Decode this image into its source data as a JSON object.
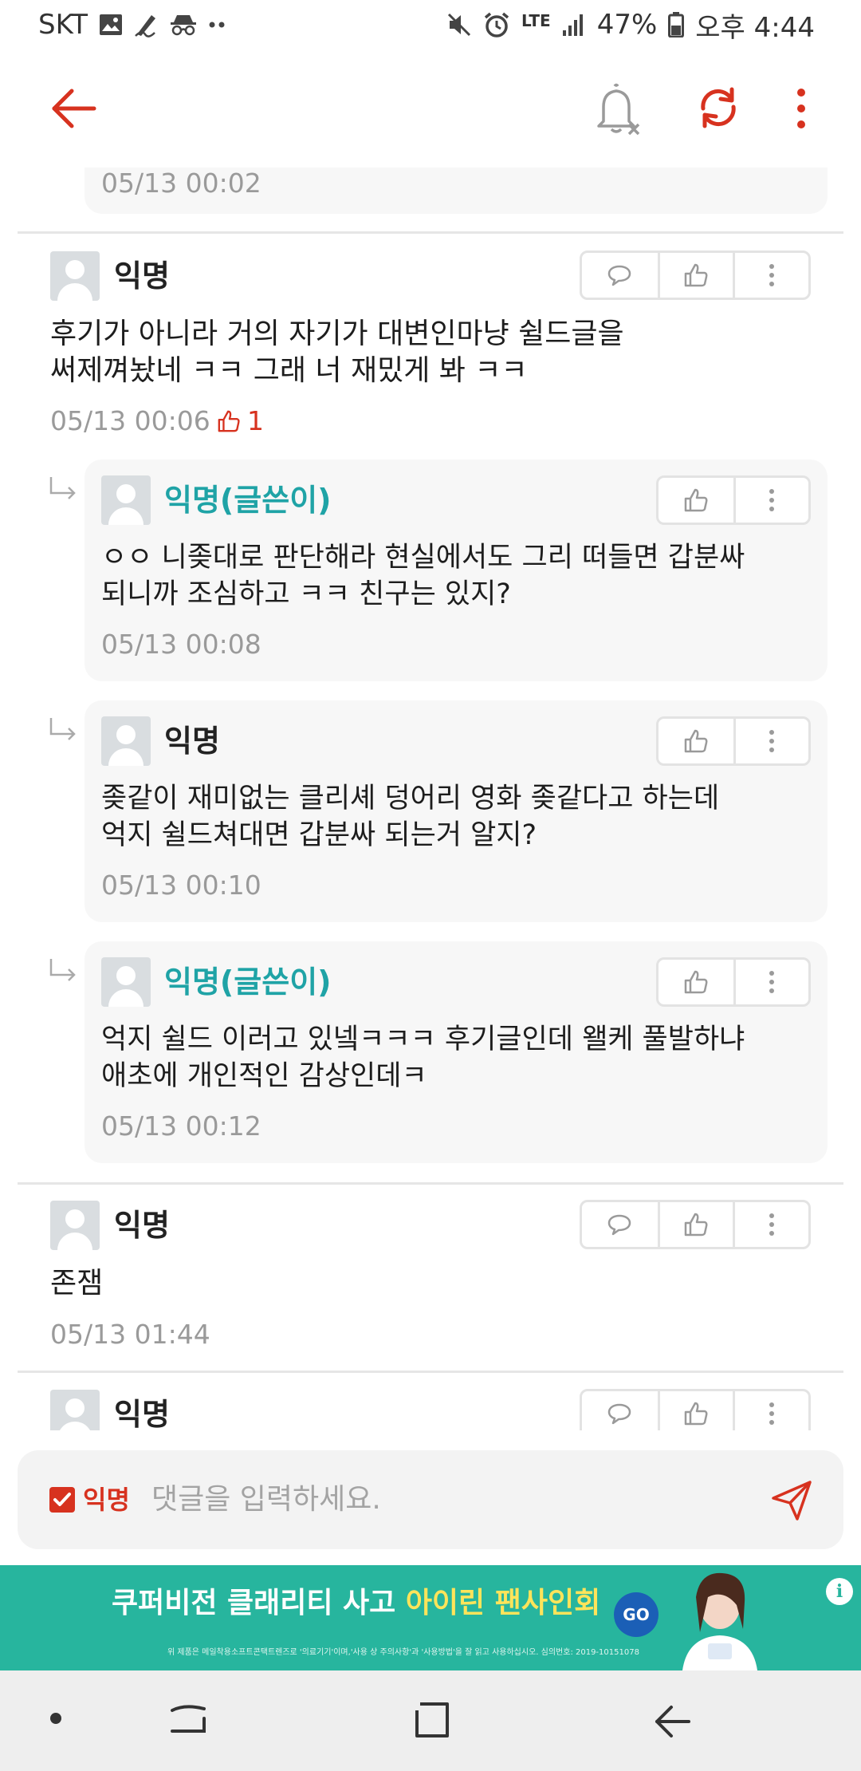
{
  "status_bar": {
    "carrier": "SKT",
    "network": "LTE",
    "battery": "47%",
    "time": "오후 4:44"
  },
  "app_bar": {
    "icons": [
      "back-arrow-icon",
      "bell-off-icon",
      "refresh-icon",
      "more-vertical-icon"
    ]
  },
  "comments": {
    "top_partial": {
      "date": "05/13 00:02"
    },
    "c1": {
      "name": "익명",
      "text": "후기가 아니라 거의 자기가 대변인마냥 쉴드글을\n써제껴놨네 ㅋㅋ 그래 너 재밌게 봐 ㅋㅋ",
      "date": "05/13 00:06",
      "likes": "1"
    },
    "r1": {
      "name": "익명(글쓴이)",
      "text": "ㅇㅇ 니좆대로 판단해라 현실에서도 그리 떠들면 갑분싸\n되니까 조심하고 ㅋㅋ 친구는 있지?",
      "date": "05/13 00:08"
    },
    "r2": {
      "name": "익명",
      "text": "좆같이 재미없는 클리셰 덩어리 영화 좆같다고 하는데\n억지 쉴드쳐대면 갑분싸 되는거 알지?",
      "date": "05/13 00:10"
    },
    "r3": {
      "name": "익명(글쓴이)",
      "text": "억지 쉴드 이러고 있넼ㅋㅋㅋ 후기글인데 왤케 풀발하냐\n애초에 개인적인 감상인데ㅋ",
      "date": "05/13 00:12"
    },
    "c2": {
      "name": "익명",
      "text": "존잼",
      "date": "05/13 01:44"
    },
    "c3": {
      "name": "익명"
    }
  },
  "composer": {
    "anonymous_label": "익명",
    "anonymous_checked": true,
    "placeholder": "댓글을 입력하세요."
  },
  "ad": {
    "headline_part1": "쿠퍼비전 클래리티 사고 ",
    "headline_part2": "아이린 팬사인회",
    "go_label": "GO",
    "fine_print": "위 제품은 메일착용소프트콘택트렌즈로 '의료기기'이며,'사용 상 주의사항'과 '사용방법'을 잘 읽고 사용하십시오. 심의번호: 2019-10151078",
    "info_label": "i"
  },
  "colors": {
    "accent": "#d7321f",
    "author_teal": "#1fa3a6",
    "ad_green": "#27b59e"
  }
}
